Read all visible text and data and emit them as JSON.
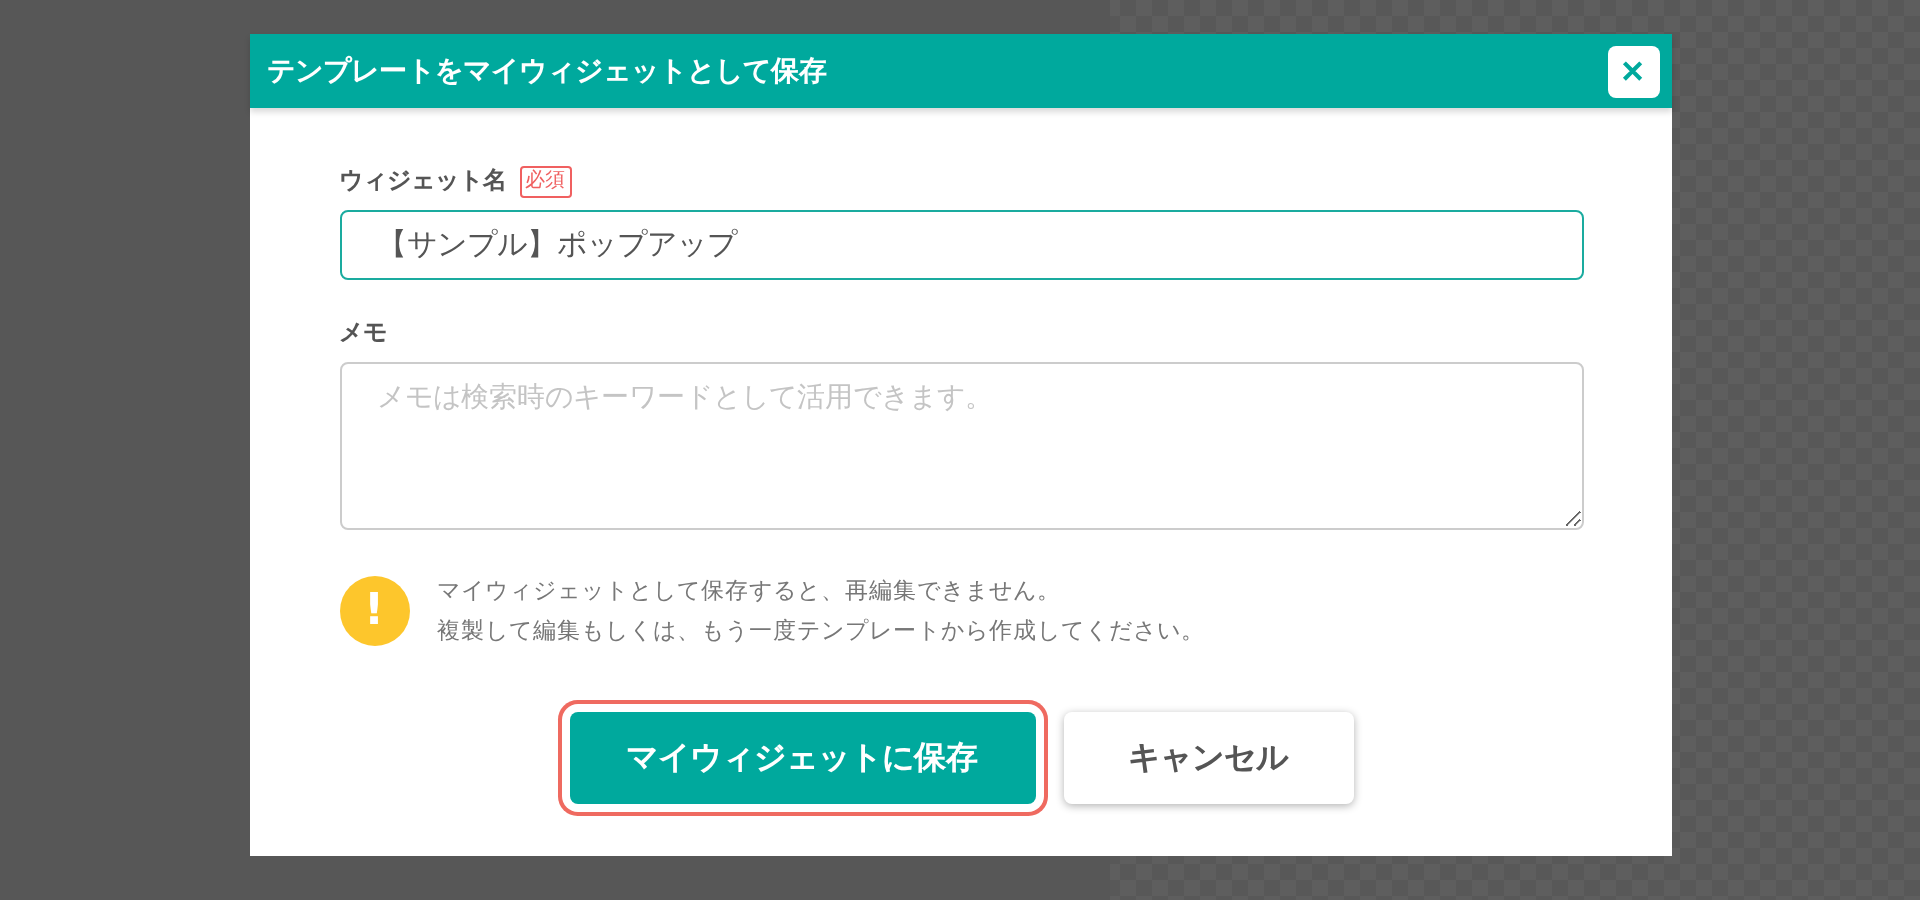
{
  "dialog": {
    "title": "テンプレートをマイウィジェットとして保存",
    "close_icon": "✕"
  },
  "fields": [
    {
      "kind": "input",
      "label": "ウィジェット名",
      "required_badge": "必須",
      "value": "【サンプル】ポップアップ",
      "focused": true
    },
    {
      "kind": "textarea",
      "label": "メモ",
      "placeholder": "メモは検索時のキーワードとして活用できます。",
      "focused": false
    }
  ],
  "warning": {
    "icon": "!",
    "lines": [
      "マイウィジェットとして保存すると、再編集できません。",
      "複製して編集もしくは、もう一度テンプレートから作成してください。"
    ]
  },
  "buttons": [
    {
      "kind": "primary",
      "label": "マイウィジェットに保存",
      "focused": true
    },
    {
      "kind": "secondary",
      "label": "キャンセル",
      "focused": false
    }
  ]
}
